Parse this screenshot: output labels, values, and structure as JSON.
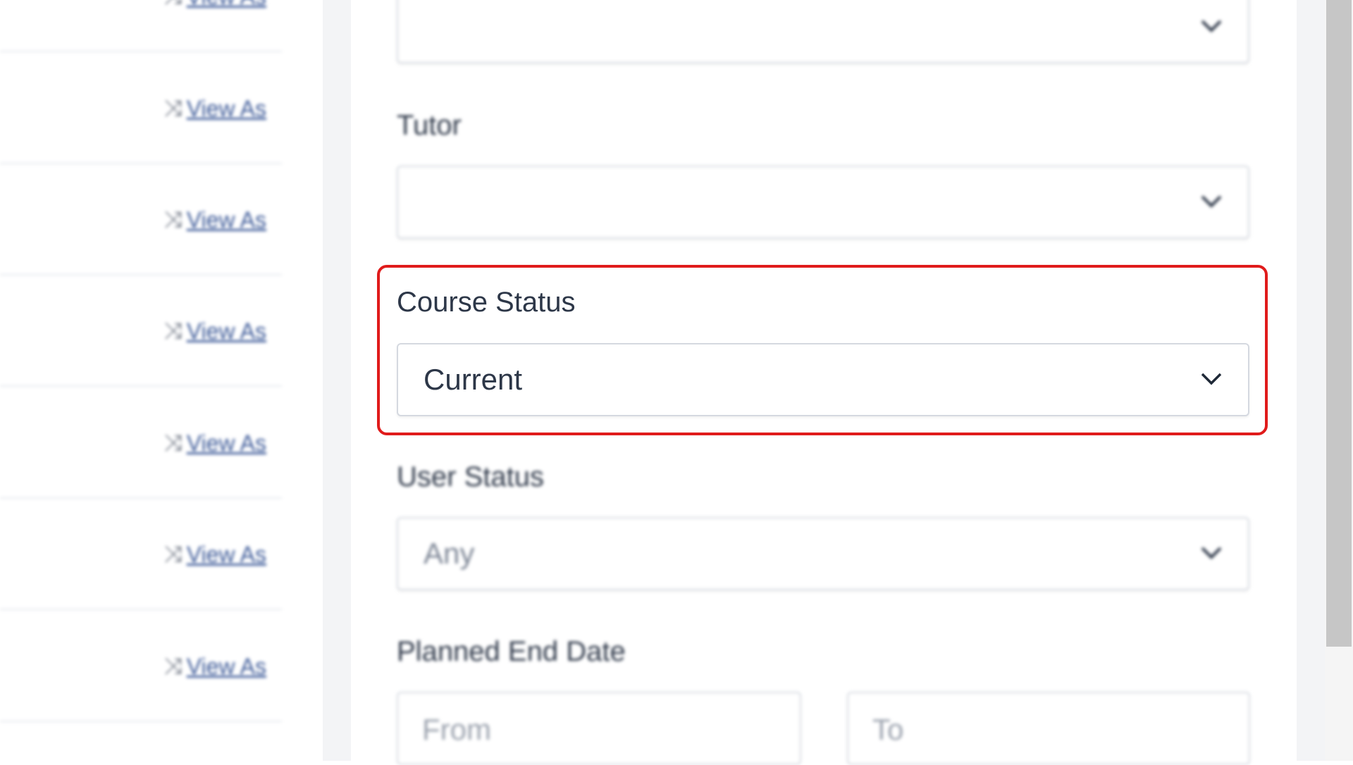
{
  "list": {
    "link_label": "View As",
    "rows": 7
  },
  "filters": {
    "top_select": {
      "value": ""
    },
    "tutor": {
      "label": "Tutor",
      "value": ""
    },
    "course_status": {
      "label": "Course Status",
      "value": "Current"
    },
    "user_status": {
      "label": "User Status",
      "value": "Any"
    },
    "planned_end_date": {
      "label": "Planned End Date",
      "from_placeholder": "From",
      "to_placeholder": "To"
    }
  },
  "colors": {
    "highlight": "#e01b1b",
    "link": "#3d5a98"
  },
  "icons": {
    "dropdown": "chevron-down-icon",
    "view_as": "shuffle-icon"
  }
}
